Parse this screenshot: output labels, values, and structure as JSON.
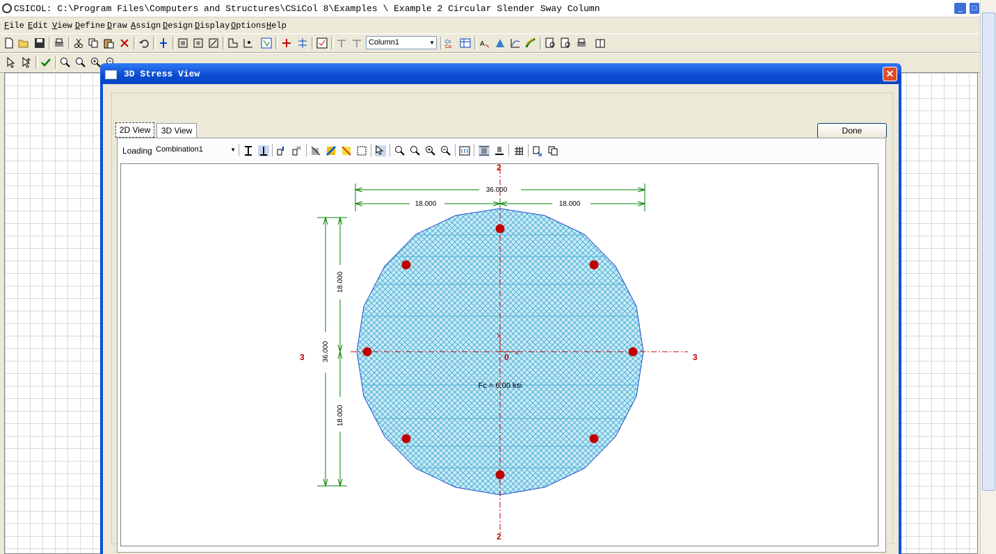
{
  "window": {
    "title": "CSICOL: C:\\Program Files\\Computers and Structures\\CSiCol 8\\Examples \\ Example 2 Circular Slender Sway Column",
    "min_glyph": "_",
    "max_glyph": "□"
  },
  "menu": [
    "File",
    "Edit",
    "View",
    "Define",
    "Draw",
    "Assign",
    "Design",
    "Display",
    "Options",
    "Help"
  ],
  "toolbar": {
    "column_combo": "Column1"
  },
  "dialog": {
    "title": "3D Stress View",
    "close_glyph": "✕",
    "tabs": [
      "2D View",
      "3D View"
    ],
    "done_label": "Done",
    "loading_label": "Loading",
    "loading_value": "Combination1"
  },
  "section": {
    "dim_total_horizontal": "36.000",
    "dim_left_half": "18.000",
    "dim_right_half": "18.000",
    "dim_total_vertical": "36.000",
    "dim_upper_half": "18.000",
    "dim_lower_half": "18.000",
    "axis2_top": "2",
    "axis2_bottom": "2",
    "axis3_left": "3",
    "axis3_right": "3",
    "origin": "0",
    "local_x": "x",
    "local_y": "y",
    "fc_label": "Fc = 6.00 ksi"
  },
  "colors": {
    "concrete_fill": "#bfe6f2",
    "hatch": "#3aa6d6",
    "outline": "#1f4fd0",
    "rebar": "#c00000",
    "dimension": "#008000",
    "axis": "#c00000"
  }
}
